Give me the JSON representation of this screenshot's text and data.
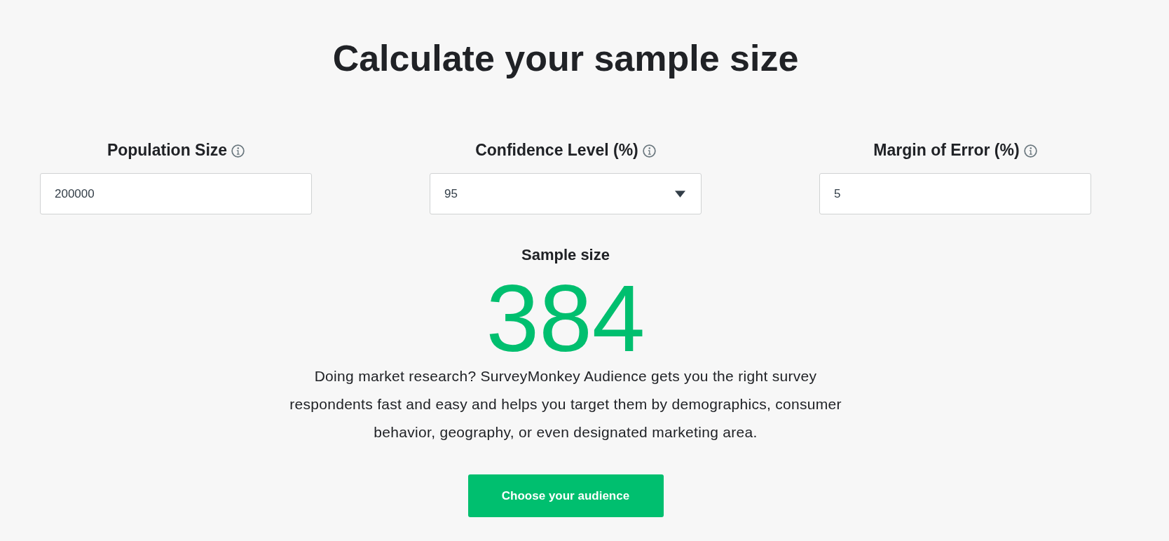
{
  "title": "Calculate your sample size",
  "fields": [
    {
      "kind": "input",
      "label": "Population Size",
      "value": "200000"
    },
    {
      "kind": "select",
      "label": "Confidence Level (%)",
      "value": "95"
    },
    {
      "kind": "input",
      "label": "Margin of Error (%)",
      "value": "5"
    }
  ],
  "result": {
    "label": "Sample size",
    "value": "384"
  },
  "description": "Doing market research? SurveyMonkey Audience gets you the right survey\nrespondents fast and easy and helps you target them by demographics, consumer\nbehavior, geography, or even designated marketing area.",
  "button": "Choose your audience"
}
